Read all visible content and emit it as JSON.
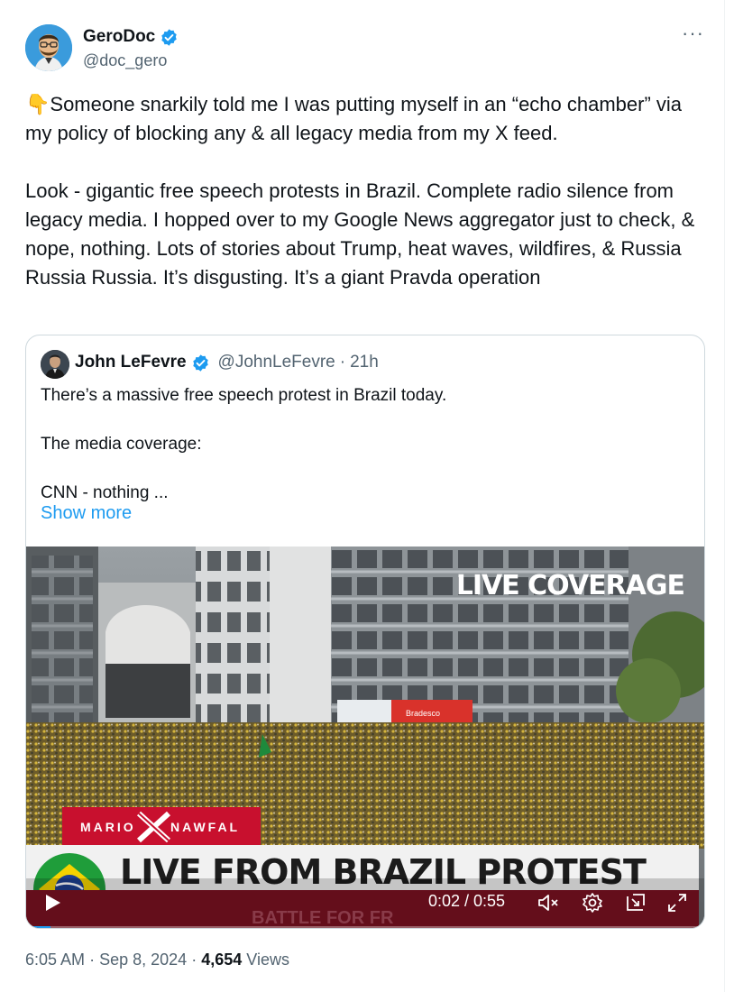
{
  "post": {
    "author_name": "GeroDoc",
    "author_handle": "@doc_gero",
    "more_label": "···",
    "text": "👇Someone snarkily told me I was putting myself in an “echo chamber” via my policy of blocking any & all legacy media from my X feed.\n\nLook - gigantic free speech protests in Brazil. Complete radio silence from legacy media. I hopped over to my Google News aggregator just to check, & nope, nothing. Lots of stories about Trump, heat waves, wildfires, & Russia Russia Russia. It’s disgusting. It’s a giant Pravda operation",
    "time": "6:05 AM",
    "date": "Sep 8, 2024",
    "views_count": "4,654",
    "views_label": "Views",
    "separator": "·"
  },
  "quoted": {
    "author_name": "John LeFevre",
    "author_handle": "@JohnLeFevre",
    "age": "21h",
    "separator": "·",
    "text": "There’s a massive free speech protest in Brazil today.\n\nThe media coverage:\n\nCNN - nothing ...",
    "show_more": "Show more"
  },
  "video": {
    "live_badge": "LIVE COVERAGE",
    "brand_left": "MARIO",
    "brand_right": "NAWFAL",
    "headline": "LIVE FROM BRAZIL PROTEST",
    "subline": "BATTLE FOR FR",
    "store_sign": "Bradesco",
    "time_display": "0:02 / 0:55",
    "progress": 0.036
  },
  "icons": {
    "verified": "verified-badge-icon",
    "more": "more-options-icon",
    "play": "play-icon",
    "mute": "volume-muted-icon",
    "settings": "gear-icon",
    "pip": "picture-in-picture-icon",
    "fullscreen": "fullscreen-icon"
  },
  "colors": {
    "accent": "#1d9bf0",
    "text": "#0f1419",
    "muted": "#536471",
    "border": "#cfd9de",
    "brand_red": "#c8102e"
  }
}
